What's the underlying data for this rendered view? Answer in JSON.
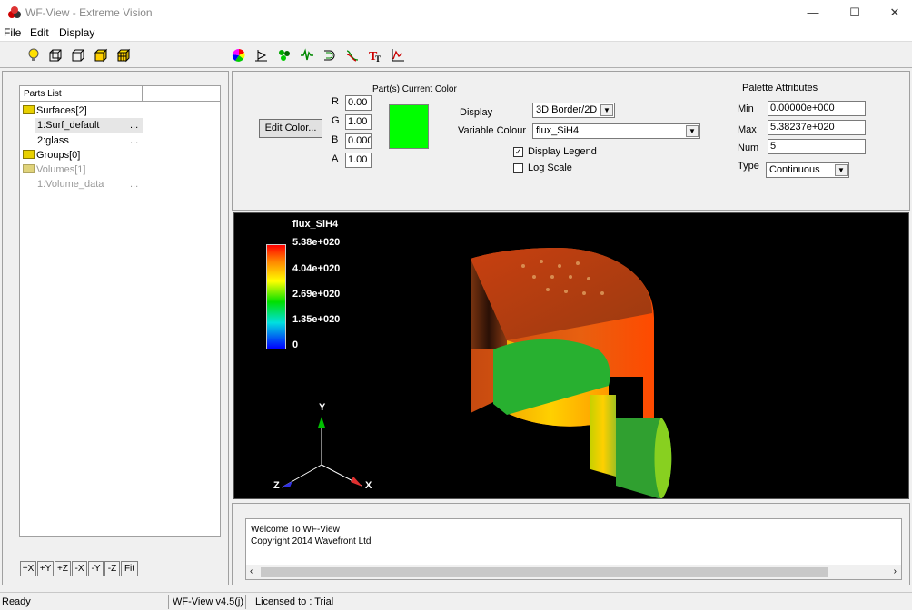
{
  "window": {
    "title": "WF-View - Extreme Vision",
    "controls": {
      "minimize": "—",
      "maximize": "☐",
      "close": "✕"
    }
  },
  "menu": {
    "items": [
      "File",
      "Edit",
      "Display"
    ]
  },
  "toolbar": {
    "icons": [
      "bulb-icon",
      "cube-wire-icon",
      "cube-outline-icon",
      "cube-solid-icon",
      "cube-grid-icon",
      "color-wheel-icon",
      "slice-icon",
      "particles-icon",
      "wave-icon",
      "isosurface-icon",
      "streamline-icon",
      "text-icon",
      "graph-icon"
    ]
  },
  "parts": {
    "header": "Parts List",
    "surfaces": {
      "label": "Surfaces[2]",
      "items": [
        {
          "name": "1:Surf_default",
          "dots": "..."
        },
        {
          "name": "2:glass",
          "dots": "..."
        }
      ]
    },
    "groups": {
      "label": "Groups[0]"
    },
    "volumes": {
      "label": "Volumes[1]",
      "items": [
        {
          "name": "1:Volume_data",
          "dots": "..."
        }
      ]
    },
    "nav_buttons": [
      "+X",
      "+Y",
      "+Z",
      "-X",
      "-Y",
      "-Z",
      "Fit"
    ]
  },
  "color_panel": {
    "edit_button": "Edit Color...",
    "current_color_label": "Part(s) Current Color",
    "swatch_color": "#00ff00",
    "r_label": "R",
    "g_label": "G",
    "b_label": "B",
    "a_label": "A",
    "r": "0.00",
    "g": "1.00",
    "b": "0.000",
    "a": "1.00"
  },
  "display_panel": {
    "display_label": "Display",
    "display_value": "3D Border/2D",
    "variable_label": "Variable Colour",
    "variable_value": "flux_SiH4",
    "legend_label": "Display Legend",
    "legend_checked": true,
    "log_label": "Log Scale",
    "log_checked": false
  },
  "palette": {
    "title": "Palette Attributes",
    "min_label": "Min",
    "min": "0.00000e+000",
    "max_label": "Max",
    "max": "5.38237e+020",
    "num_label": "Num",
    "num": "5",
    "type_label": "Type",
    "type": "Continuous"
  },
  "viewport": {
    "legend_title": "flux_SiH4",
    "legend_values": [
      "5.38e+020",
      "4.04e+020",
      "2.69e+020",
      "1.35e+020",
      "0"
    ],
    "axes": {
      "y": "Y",
      "x": "X",
      "z": "Z"
    }
  },
  "console": {
    "lines": [
      "Welcome To WF-View",
      "Copyright 2014 Wavefront Ltd"
    ]
  },
  "status": {
    "ready": "Ready",
    "version": "WF-View v4.5(j)",
    "license": "Licensed to : Trial"
  }
}
